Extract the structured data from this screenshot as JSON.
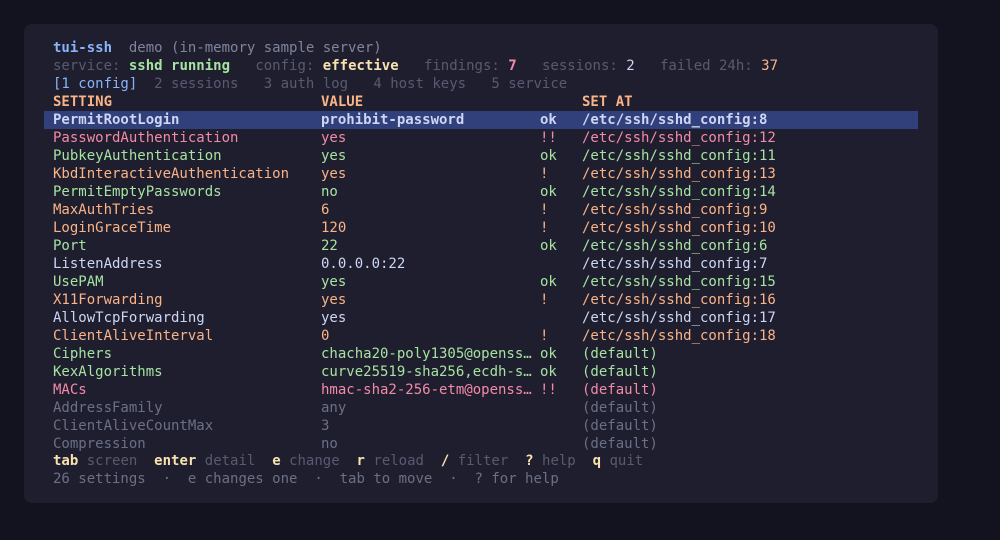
{
  "app": {
    "name": "tui-ssh",
    "subtitle": "demo (in-memory sample server)"
  },
  "status": {
    "service_label": "service:",
    "service_value": "sshd running",
    "config_label": "config:",
    "config_value": "effective",
    "findings_label": "findings:",
    "findings_value": "7",
    "sessions_label": "sessions:",
    "sessions_value": "2",
    "failed_label": "failed 24h:",
    "failed_value": "37"
  },
  "tabs": [
    {
      "label": "[1 config]",
      "active": true
    },
    {
      "label": "2 sessions",
      "active": false
    },
    {
      "label": "3 auth log",
      "active": false
    },
    {
      "label": "4 host keys",
      "active": false
    },
    {
      "label": "5 service",
      "active": false
    }
  ],
  "table": {
    "headers": {
      "setting": "SETTING",
      "value": "VALUE",
      "source": "SET AT"
    },
    "rows": [
      {
        "setting": "PermitRootLogin",
        "value": "prohibit-password",
        "flag": "ok",
        "source": "/etc/ssh/sshd_config:8",
        "status": "ok",
        "selected": true
      },
      {
        "setting": "PasswordAuthentication",
        "value": "yes",
        "flag": "!!",
        "source": "/etc/ssh/sshd_config:12",
        "status": "bad"
      },
      {
        "setting": "PubkeyAuthentication",
        "value": "yes",
        "flag": "ok",
        "source": "/etc/ssh/sshd_config:11",
        "status": "ok"
      },
      {
        "setting": "KbdInteractiveAuthentication",
        "value": "yes",
        "flag": "!",
        "source": "/etc/ssh/sshd_config:13",
        "status": "warn"
      },
      {
        "setting": "PermitEmptyPasswords",
        "value": "no",
        "flag": "ok",
        "source": "/etc/ssh/sshd_config:14",
        "status": "ok"
      },
      {
        "setting": "MaxAuthTries",
        "value": "6",
        "flag": "!",
        "source": "/etc/ssh/sshd_config:9",
        "status": "warn"
      },
      {
        "setting": "LoginGraceTime",
        "value": "120",
        "flag": "!",
        "source": "/etc/ssh/sshd_config:10",
        "status": "warn"
      },
      {
        "setting": "Port",
        "value": "22",
        "flag": "ok",
        "source": "/etc/ssh/sshd_config:6",
        "status": "ok"
      },
      {
        "setting": "ListenAddress",
        "value": "0.0.0.0:22",
        "flag": "",
        "source": "/etc/ssh/sshd_config:7",
        "status": "info"
      },
      {
        "setting": "UsePAM",
        "value": "yes",
        "flag": "ok",
        "source": "/etc/ssh/sshd_config:15",
        "status": "ok"
      },
      {
        "setting": "X11Forwarding",
        "value": "yes",
        "flag": "!",
        "source": "/etc/ssh/sshd_config:16",
        "status": "warn"
      },
      {
        "setting": "AllowTcpForwarding",
        "value": "yes",
        "flag": "",
        "source": "/etc/ssh/sshd_config:17",
        "status": "info"
      },
      {
        "setting": "ClientAliveInterval",
        "value": "0",
        "flag": "!",
        "source": "/etc/ssh/sshd_config:18",
        "status": "warn"
      },
      {
        "setting": "Ciphers",
        "value": "chacha20-poly1305@openss…",
        "flag": "ok",
        "source": "(default)",
        "status": "ok"
      },
      {
        "setting": "KexAlgorithms",
        "value": "curve25519-sha256,ecdh-s…",
        "flag": "ok",
        "source": "(default)",
        "status": "ok"
      },
      {
        "setting": "MACs",
        "value": "hmac-sha2-256-etm@openss…",
        "flag": "!!",
        "source": "(default)",
        "status": "bad"
      },
      {
        "setting": "AddressFamily",
        "value": "any",
        "flag": "",
        "source": "(default)",
        "status": "default"
      },
      {
        "setting": "ClientAliveCountMax",
        "value": "3",
        "flag": "",
        "source": "(default)",
        "status": "default"
      },
      {
        "setting": "Compression",
        "value": "no",
        "flag": "",
        "source": "(default)",
        "status": "default"
      }
    ]
  },
  "keys": [
    {
      "key": "tab",
      "desc": "screen"
    },
    {
      "key": "enter",
      "desc": "detail"
    },
    {
      "key": "e",
      "desc": "change"
    },
    {
      "key": "r",
      "desc": "reload"
    },
    {
      "key": "/",
      "desc": "filter"
    },
    {
      "key": "?",
      "desc": "help"
    },
    {
      "key": "q",
      "desc": "quit"
    }
  ],
  "footer": {
    "count": "26 settings",
    "hint1": "e changes one",
    "hint2": "tab to move",
    "hint3": "? for help",
    "separator": "·"
  },
  "colors": {
    "background": "#13131f",
    "window": "#1e1e2e",
    "selection": "#313f7a",
    "ok": "#a6e3a1",
    "warn": "#fab387",
    "bad": "#f38ba8",
    "info": "#cdd6f4",
    "default": "#6c7086"
  }
}
